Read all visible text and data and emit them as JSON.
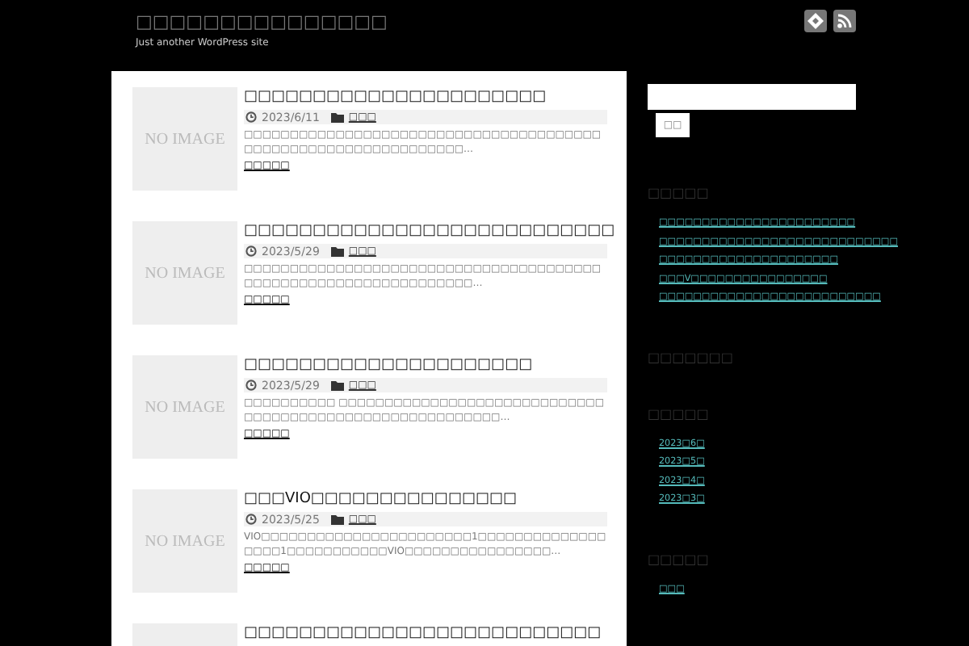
{
  "site": {
    "title": "□□□□□□□□□□□□□□□",
    "tagline": "Just another WordPress site"
  },
  "posts": [
    {
      "thumb": "NO IMAGE",
      "title": "□□□□□□□□□□□□□□□□□□□□□□",
      "date": "2023/6/11",
      "category": "□□□",
      "excerpt": "□□□□□□□□□□□□□□□□□□□□□□□□□□□□□□□□□□□□□□□□□□□□□□□□□□□□□□□□□□□□□□□…",
      "more": "□□□□□"
    },
    {
      "thumb": "NO IMAGE",
      "title": "□□□□□□□□□□□□□□□□□□□□□□□□□□□",
      "date": "2023/5/29",
      "category": "□□□",
      "excerpt": "□□□□□□□□□□□□□□□□□□□□□□□□□□□□□□□□□□□□□□□□□□□□□□□□□□□□□□□□□□□□□□□□…",
      "more": "□□□□□"
    },
    {
      "thumb": "NO IMAGE",
      "title": "□□□□□□□□□□□□□□□□□□□□□",
      "date": "2023/5/29",
      "category": "□□□",
      "excerpt": "□□□□□□□□□□ □□□□□□□□□□□□□□□□□□□□□□□□□□□□□□□□□□□□□□□□□□□□□□□□□□□□□□□□□…",
      "more": "□□□□□"
    },
    {
      "thumb": "NO IMAGE",
      "title": "□□□VIO□□□□□□□□□□□□□□□",
      "date": "2023/5/25",
      "category": "□□□",
      "excerpt": "VIO□□□□□□□□□□□□□□□□□□□□□□□1□□□□□□□□□□□□□□□□□□1□□□□□□□□□□□VIO□□□□□□□□□□□□□□□□…",
      "more": "□□□□□"
    },
    {
      "title": "□□□□□□□□□□□□□□□□□□□□□□□□□□"
    }
  ],
  "search": {
    "button": "□□"
  },
  "widgets": [
    {
      "title": "□□□□□",
      "links": [
        "□□□□□□□□□□□□□□□□□□□□□□□",
        "□□□□□□□□□□□□□□□□□□□□□□□□□□□□",
        "□□□□□□□□□□□□□□□□□□□□□",
        "□□□V□□□□□□□□□□□□□□□□",
        "□□□□□□□□□□□□□□□□□□□□□□□□□□"
      ]
    },
    {
      "title": "□□□□□□□"
    },
    {
      "title": "□□□□□",
      "links": [
        "2023□6□",
        "2023□5□",
        "2023□4□",
        "2023□3□"
      ]
    },
    {
      "title": "□□□□□",
      "links": [
        "□□□"
      ]
    }
  ]
}
